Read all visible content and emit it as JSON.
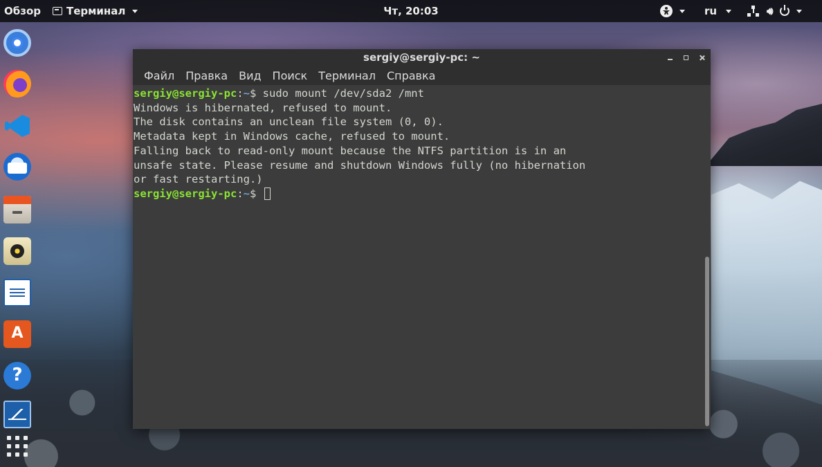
{
  "topbar": {
    "overview": "Обзор",
    "app_menu": "Терминал",
    "clock": "Чт, 20:03",
    "language": "ru"
  },
  "dock": {
    "items": [
      {
        "name": "chromium",
        "icon": "chromium-icon"
      },
      {
        "name": "firefox",
        "icon": "firefox-icon"
      },
      {
        "name": "vscode",
        "icon": "vscode-icon"
      },
      {
        "name": "thunderbird",
        "icon": "thunderbird-icon"
      },
      {
        "name": "files",
        "icon": "files-icon"
      },
      {
        "name": "rhythmbox",
        "icon": "rhythmbox-icon"
      },
      {
        "name": "libreoffice-writer",
        "icon": "writer-icon"
      },
      {
        "name": "software",
        "icon": "software-store-icon"
      },
      {
        "name": "help",
        "icon": "help-icon"
      },
      {
        "name": "system-monitor",
        "icon": "system-monitor-icon"
      },
      {
        "name": "show-applications",
        "icon": "app-grid-icon"
      }
    ]
  },
  "window": {
    "title": "sergiy@sergiy-pc: ~",
    "menu": [
      "Файл",
      "Правка",
      "Вид",
      "Поиск",
      "Терминал",
      "Справка"
    ]
  },
  "terminal": {
    "prompt_user": "sergiy@sergiy-pc",
    "prompt_sep": ":",
    "prompt_path": "~",
    "prompt_sym": "$ ",
    "command": "sudo mount /dev/sda2 /mnt",
    "output": [
      "Windows is hibernated, refused to mount.",
      "The disk contains an unclean file system (0, 0).",
      "Metadata kept in Windows cache, refused to mount.",
      "Falling back to read-only mount because the NTFS partition is in an",
      "unsafe state. Please resume and shutdown Windows fully (no hibernation",
      "or fast restarting.)"
    ]
  },
  "colors": {
    "terminal_bg": "#3c3c3c",
    "prompt_user": "#8ae234",
    "prompt_path": "#729fcf",
    "text": "#d3d7cf"
  }
}
